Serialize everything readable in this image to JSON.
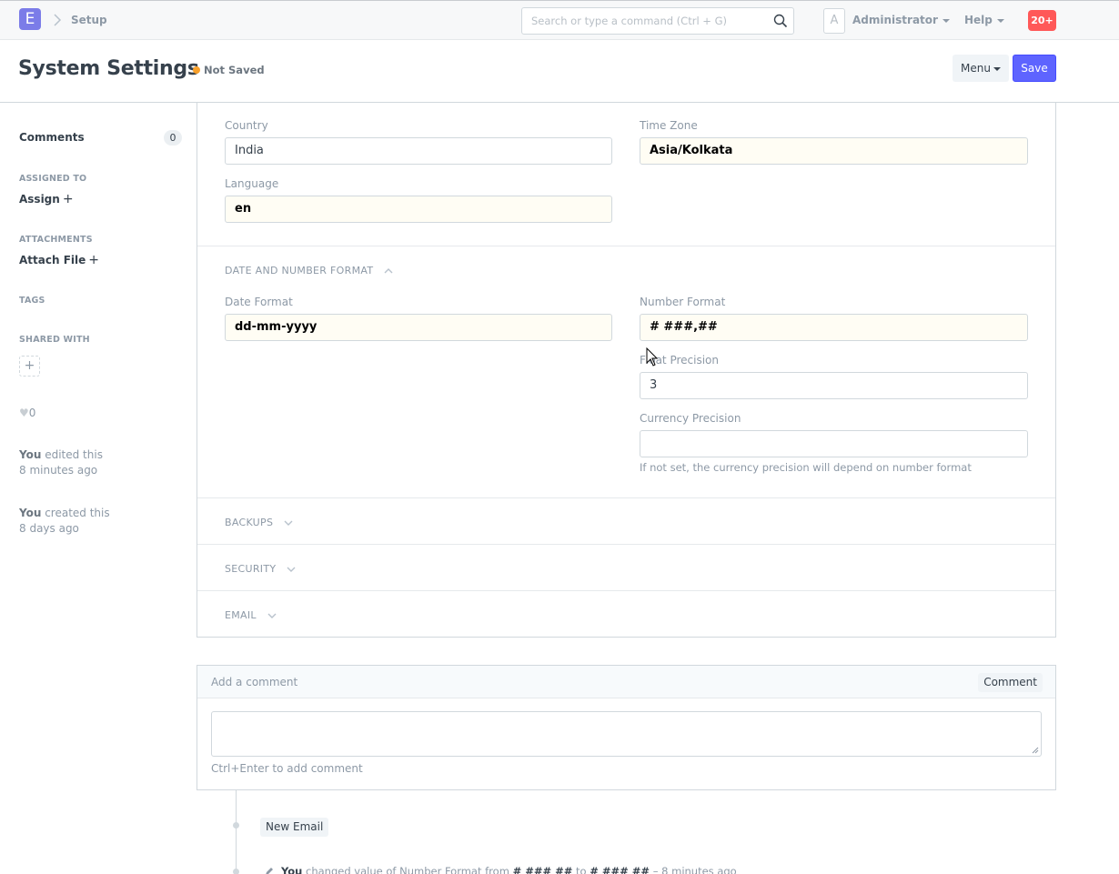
{
  "navbar": {
    "logo_letter": "E",
    "breadcrumb": "Setup",
    "search_placeholder": "Search or type a command (Ctrl + G)",
    "avatar_letter": "A",
    "user_name": "Administrator",
    "help_label": "Help",
    "notification_count": "20+"
  },
  "page_head": {
    "title": "System Settings",
    "status": "Not Saved",
    "menu_label": "Menu",
    "save_label": "Save"
  },
  "sidebar": {
    "comments_label": "Comments",
    "comments_count": "0",
    "assigned_to_label": "ASSIGNED TO",
    "assign_label": "Assign",
    "attachments_label": "ATTACHMENTS",
    "attach_file_label": "Attach File",
    "tags_label": "TAGS",
    "shared_with_label": "SHARED WITH",
    "likes_count": "0",
    "activity": [
      {
        "who": "You",
        "action": "edited this",
        "when": "8 minutes ago"
      },
      {
        "who": "You",
        "action": "created this",
        "when": "8 days ago"
      }
    ]
  },
  "form": {
    "country_label": "Country",
    "country_value": "India",
    "timezone_label": "Time Zone",
    "timezone_value": "Asia/Kolkata",
    "language_label": "Language",
    "language_value": "en",
    "section_date_number": "DATE AND NUMBER FORMAT",
    "date_format_label": "Date Format",
    "date_format_value": "dd-mm-yyyy",
    "number_format_label": "Number Format",
    "number_format_value": "# ###,##",
    "float_precision_label": "Float Precision",
    "float_precision_value": "3",
    "currency_precision_label": "Currency Precision",
    "currency_precision_value": "",
    "currency_precision_help": "If not set, the currency precision will depend on number format",
    "section_backups": "BACKUPS",
    "section_security": "SECURITY",
    "section_email": "EMAIL"
  },
  "comment": {
    "header_label": "Add a comment",
    "button_label": "Comment",
    "help": "Ctrl+Enter to add comment"
  },
  "timeline": {
    "new_email_label": "New Email",
    "entry_who": "You",
    "entry_text": "changed value of Number Format from",
    "entry_from": "# ### ##",
    "entry_to_word": "to",
    "entry_to": "# ### ##",
    "entry_when": "– 8 minutes ago"
  },
  "colors": {
    "primary": "#5e64ff",
    "logo": "#7b7ce8",
    "notification": "#ff5858",
    "not_saved_indicator": "#f8a02b",
    "dirty_field_bg": "#fffdf4"
  },
  "icons": [
    "search-icon",
    "chevron-right-icon",
    "caret-down-icon",
    "chevron-up-icon",
    "chevron-down-icon",
    "plus-icon",
    "heart-icon",
    "pencil-icon",
    "mouse-cursor-icon"
  ]
}
